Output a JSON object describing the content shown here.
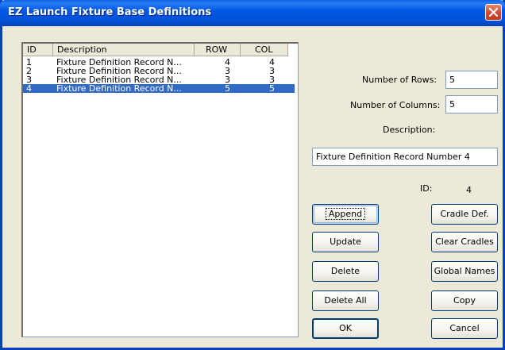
{
  "window": {
    "title": "EZ Launch Fixture Base Definitions",
    "close_icon": "close-icon"
  },
  "list": {
    "columns": [
      "ID",
      "Description",
      "ROW",
      "COL"
    ],
    "rows": [
      {
        "id": "1",
        "description": "Fixture Definition Record N...",
        "row": "4",
        "col": "4",
        "selected": false
      },
      {
        "id": "2",
        "description": "Fixture Definition Record N...",
        "row": "3",
        "col": "3",
        "selected": false
      },
      {
        "id": "3",
        "description": "Fixture Definition Record N...",
        "row": "3",
        "col": "3",
        "selected": false
      },
      {
        "id": "4",
        "description": "Fixture Definition Record N...",
        "row": "5",
        "col": "5",
        "selected": true
      }
    ]
  },
  "form": {
    "rows_label": "Number of Rows:",
    "rows_value": "5",
    "cols_label": "Number of Columns:",
    "cols_value": "5",
    "description_label": "Description:",
    "description_value": "Fixture Definition Record Number 4",
    "id_label": "ID:",
    "id_value": "4"
  },
  "buttons": {
    "append": "Append",
    "update": "Update",
    "delete": "Delete",
    "delete_all": "Delete All",
    "ok": "OK",
    "cradle_def": "Cradle Def.",
    "clear_cradles": "Clear Cradles",
    "global_names": "Global Names",
    "copy": "Copy",
    "cancel": "Cancel"
  }
}
